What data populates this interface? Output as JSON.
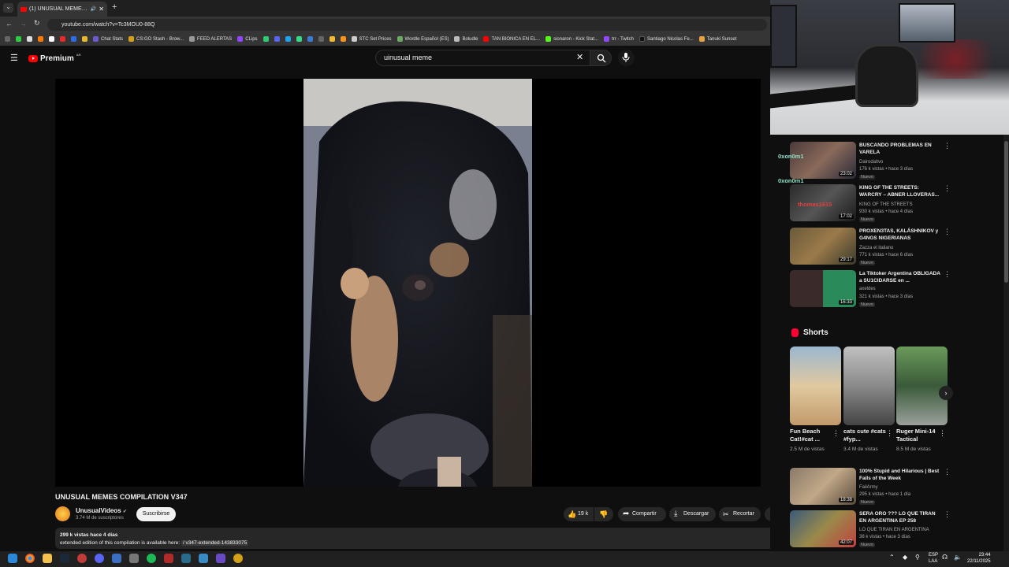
{
  "browser": {
    "tab_title": "(1) UNUSUAL MEMES COM",
    "url": "youtube.com/watch?v=Tc3MOU0-88Q",
    "bookmarks": [
      "Chat Stats",
      "CS:GO Stash - Brow...",
      "FEED ALERTAS",
      "CLips",
      "STC Set Prices",
      "Wordle Español (ES)",
      "Boludle",
      "TAN BIONICA EN EL...",
      "sionaron - Kick Stat...",
      "trr - Twitch",
      "Santiago Nicolas Fe...",
      "Tanuki Sunset"
    ]
  },
  "youtube": {
    "logo": "Premium",
    "logo_region": "AR",
    "search_query": "uinusual meme"
  },
  "video": {
    "title": "UNUSUAL MEMES COMPILATION V347",
    "channel": "UnusualVideos",
    "subscribers": "3.74 M de suscriptores",
    "subscribe_label": "Suscribirse",
    "likes": "19 k",
    "share_label": "Compartir",
    "download_label": "Descargar",
    "clip_label": "Recortar",
    "views_age": "299 k vistas  hace 4 días",
    "description": "extended edition of this compilation is available here:",
    "description_link": "/ v347-extended-143833075"
  },
  "chat": {
    "user1": "0xon0m1",
    "user2": "0xon0m1",
    "user3": "thomas1615"
  },
  "related": [
    {
      "title": "BUSCANDO PROBLEMAS EN VARELA",
      "channel": "Dairodaltvo",
      "meta": "176 k vistas • hace 3 días",
      "badge": "Nuevo",
      "duration": "23:02"
    },
    {
      "title": "KING OF THE STREETS: WARCRY – ABNER LLOVERAS...",
      "channel": "KING OF THE STREETS",
      "meta": "930 k vistas • hace 4 días",
      "badge": "Nuevo",
      "duration": "17:02"
    },
    {
      "title": "PROXEN3TAS, KALÁSHNIKOV y G4NGS NIGERIANAS",
      "channel": "Zazza el italiano",
      "meta": "771 k vistas • hace 6 días",
      "badge": "Nuevo",
      "duration": "29:17"
    },
    {
      "title": "La Tiktoker Argentina OBLIGADA a SU1CIDARSE en ...",
      "channel": "axeldes",
      "meta": "321 k vistas • hace 3 días",
      "badge": "Nuevo",
      "duration": "16:33"
    }
  ],
  "shorts": {
    "header": "Shorts",
    "items": [
      {
        "title": "Fun Beach Cat!#cat ...",
        "views": "2.5 M de vistas"
      },
      {
        "title": "cats cute #cats #fyp...",
        "views": "3.4 M de vistas"
      },
      {
        "title": "Ruger Mini-14 Tactical",
        "views": "8.5 M de vistas"
      }
    ]
  },
  "related2": [
    {
      "title": "100% Stupid and Hilarious | Best Fails of the Week",
      "channel": "FailArmy",
      "meta": "295 k vistas • hace 1 día",
      "badge": "Nuevo",
      "duration": "18:38"
    },
    {
      "title": "SERA ORO ??? LO QUE TIRAN EN ARGENTINA EP 258",
      "channel": "LO QUE TIRAN EN ARGENTINA",
      "meta": "38 k vistas • hace 3 días",
      "badge": "Nuevo",
      "duration": "42:07"
    }
  ],
  "taskbar": {
    "lang1": "ESP",
    "lang2": "LAA",
    "time": "23:44",
    "date": "22/11/2025"
  }
}
